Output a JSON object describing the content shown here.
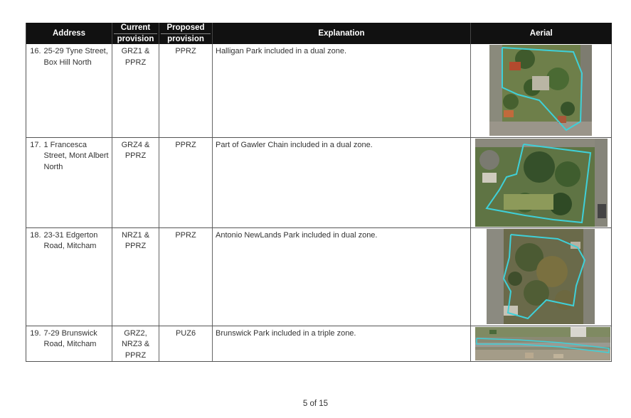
{
  "table": {
    "headers": {
      "address": "Address",
      "current": [
        "Current",
        "provision"
      ],
      "proposed": [
        "Proposed",
        "provision"
      ],
      "explanation": "Explanation",
      "aerial": "Aerial"
    },
    "rows": [
      {
        "num": "16.",
        "address": "25-29 Tyne Street, Box Hill North",
        "current": "GRZ1 & PPRZ",
        "proposed": "PPRZ",
        "explanation": "Halligan Park included in a dual zone."
      },
      {
        "num": "17.",
        "address": "1 Francesca Street, Mont Albert North",
        "current": "GRZ4 & PPRZ",
        "proposed": "PPRZ",
        "explanation": "Part of Gawler Chain included in a dual zone."
      },
      {
        "num": "18.",
        "address": "23-31 Edgerton Road, Mitcham",
        "current": "NRZ1 & PPRZ",
        "proposed": "PPRZ",
        "explanation": "Antonio NewLands Park included in dual zone."
      },
      {
        "num": "19.",
        "address": "7-29 Brunswick Road, Mitcham",
        "current": "GRZ2, NRZ3 & PPRZ",
        "proposed": "PUZ6",
        "explanation": "Brunswick Park included in a triple zone."
      }
    ]
  },
  "footer": {
    "page": "5 of 15"
  },
  "colors": {
    "header_bg": "#111111",
    "boundary": "#3fd0d8"
  }
}
